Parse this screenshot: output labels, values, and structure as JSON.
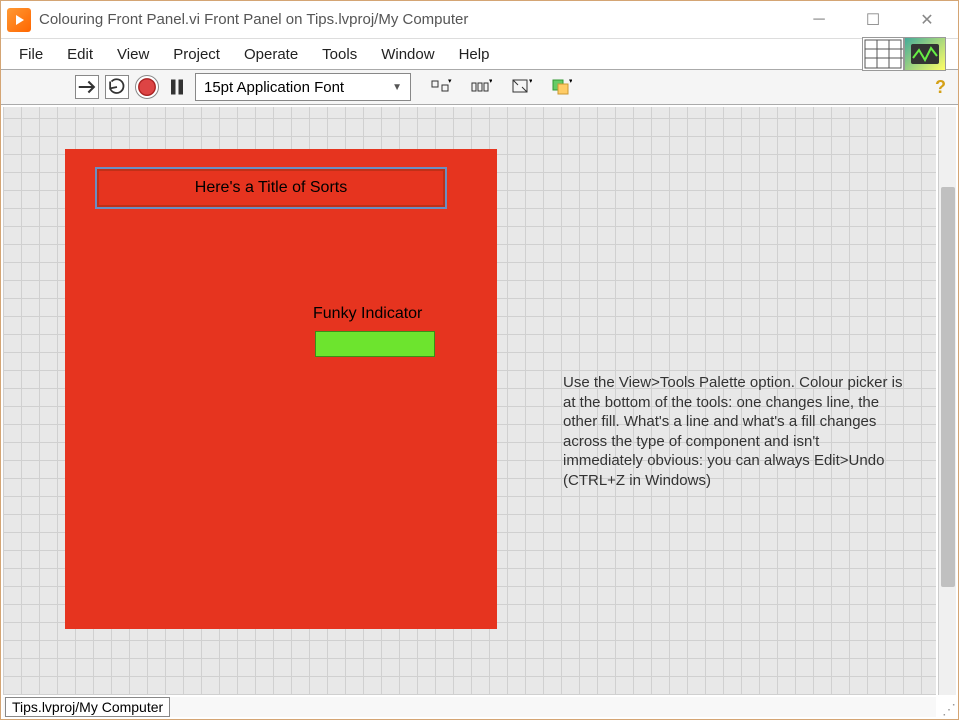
{
  "window": {
    "title": "Colouring Front Panel.vi Front Panel on Tips.lvproj/My Computer"
  },
  "menubar": {
    "items": [
      "File",
      "Edit",
      "View",
      "Project",
      "Operate",
      "Tools",
      "Window",
      "Help"
    ]
  },
  "toolbar": {
    "font_label": "15pt Application Font"
  },
  "panel": {
    "title_text": "Here's a Title of Sorts",
    "indicator_label": "Funky Indicator"
  },
  "help_text": "Use the View>Tools Palette option.  Colour picker is at the bottom of the tools: one changes line, the other fill.  What's a line and what's a fill changes across the type of component and isn't immediately obvious: you can always Edit>Undo (CTRL+Z in Windows)",
  "status": {
    "path": "Tips.lvproj/My Computer"
  }
}
